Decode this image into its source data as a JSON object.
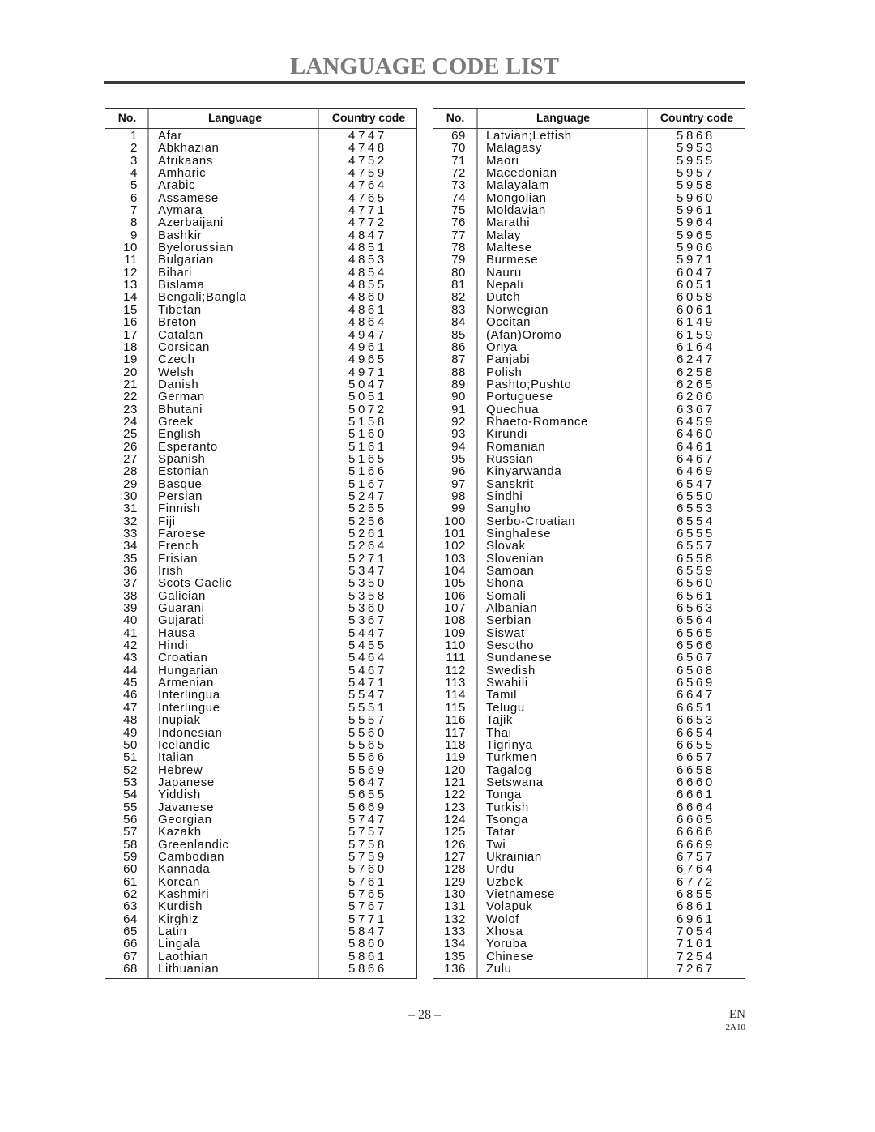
{
  "title": "LANGUAGE CODE LIST",
  "headers": {
    "no": "No.",
    "language": "Language",
    "code": "Country code"
  },
  "left_table": [
    {
      "no": "1",
      "language": "Afar",
      "code": "4747"
    },
    {
      "no": "2",
      "language": "Abkhazian",
      "code": "4748"
    },
    {
      "no": "3",
      "language": "Afrikaans",
      "code": "4752"
    },
    {
      "no": "4",
      "language": "Amharic",
      "code": "4759"
    },
    {
      "no": "5",
      "language": "Arabic",
      "code": "4764"
    },
    {
      "no": "6",
      "language": "Assamese",
      "code": "4765"
    },
    {
      "no": "7",
      "language": "Aymara",
      "code": "4771"
    },
    {
      "no": "8",
      "language": "Azerbaijani",
      "code": "4772"
    },
    {
      "no": "9",
      "language": "Bashkir",
      "code": "4847"
    },
    {
      "no": "10",
      "language": "Byelorussian",
      "code": "4851"
    },
    {
      "no": "11",
      "language": "Bulgarian",
      "code": "4853"
    },
    {
      "no": "12",
      "language": "Bihari",
      "code": "4854"
    },
    {
      "no": "13",
      "language": "Bislama",
      "code": "4855"
    },
    {
      "no": "14",
      "language": "Bengali;Bangla",
      "code": "4860"
    },
    {
      "no": "15",
      "language": "Tibetan",
      "code": "4861"
    },
    {
      "no": "16",
      "language": "Breton",
      "code": "4864"
    },
    {
      "no": "17",
      "language": "Catalan",
      "code": "4947"
    },
    {
      "no": "18",
      "language": "Corsican",
      "code": "4961"
    },
    {
      "no": "19",
      "language": "Czech",
      "code": "4965"
    },
    {
      "no": "20",
      "language": "Welsh",
      "code": "4971"
    },
    {
      "no": "21",
      "language": "Danish",
      "code": "5047"
    },
    {
      "no": "22",
      "language": "German",
      "code": "5051"
    },
    {
      "no": "23",
      "language": "Bhutani",
      "code": "5072"
    },
    {
      "no": "24",
      "language": "Greek",
      "code": "5158"
    },
    {
      "no": "25",
      "language": "English",
      "code": "5160"
    },
    {
      "no": "26",
      "language": "Esperanto",
      "code": "5161"
    },
    {
      "no": "27",
      "language": "Spanish",
      "code": "5165"
    },
    {
      "no": "28",
      "language": "Estonian",
      "code": "5166"
    },
    {
      "no": "29",
      "language": "Basque",
      "code": "5167"
    },
    {
      "no": "30",
      "language": "Persian",
      "code": "5247"
    },
    {
      "no": "31",
      "language": "Finnish",
      "code": "5255"
    },
    {
      "no": "32",
      "language": "Fiji",
      "code": "5256"
    },
    {
      "no": "33",
      "language": "Faroese",
      "code": "5261"
    },
    {
      "no": "34",
      "language": "French",
      "code": "5264"
    },
    {
      "no": "35",
      "language": "Frisian",
      "code": "5271"
    },
    {
      "no": "36",
      "language": "Irish",
      "code": "5347"
    },
    {
      "no": "37",
      "language": "Scots Gaelic",
      "code": "5350"
    },
    {
      "no": "38",
      "language": "Galician",
      "code": "5358"
    },
    {
      "no": "39",
      "language": "Guarani",
      "code": "5360"
    },
    {
      "no": "40",
      "language": "Gujarati",
      "code": "5367"
    },
    {
      "no": "41",
      "language": "Hausa",
      "code": "5447"
    },
    {
      "no": "42",
      "language": "Hindi",
      "code": "5455"
    },
    {
      "no": "43",
      "language": "Croatian",
      "code": "5464"
    },
    {
      "no": "44",
      "language": "Hungarian",
      "code": "5467"
    },
    {
      "no": "45",
      "language": "Armenian",
      "code": "5471"
    },
    {
      "no": "46",
      "language": "Interlingua",
      "code": "5547"
    },
    {
      "no": "47",
      "language": "Interlingue",
      "code": "5551"
    },
    {
      "no": "48",
      "language": "Inupiak",
      "code": "5557"
    },
    {
      "no": "49",
      "language": "Indonesian",
      "code": "5560"
    },
    {
      "no": "50",
      "language": "Icelandic",
      "code": "5565"
    },
    {
      "no": "51",
      "language": "Italian",
      "code": "5566"
    },
    {
      "no": "52",
      "language": "Hebrew",
      "code": "5569"
    },
    {
      "no": "53",
      "language": "Japanese",
      "code": "5647"
    },
    {
      "no": "54",
      "language": "Yiddish",
      "code": "5655"
    },
    {
      "no": "55",
      "language": "Javanese",
      "code": "5669"
    },
    {
      "no": "56",
      "language": "Georgian",
      "code": "5747"
    },
    {
      "no": "57",
      "language": "Kazakh",
      "code": "5757"
    },
    {
      "no": "58",
      "language": "Greenlandic",
      "code": "5758"
    },
    {
      "no": "59",
      "language": "Cambodian",
      "code": "5759"
    },
    {
      "no": "60",
      "language": "Kannada",
      "code": "5760"
    },
    {
      "no": "61",
      "language": "Korean",
      "code": "5761"
    },
    {
      "no": "62",
      "language": "Kashmiri",
      "code": "5765"
    },
    {
      "no": "63",
      "language": "Kurdish",
      "code": "5767"
    },
    {
      "no": "64",
      "language": "Kirghiz",
      "code": "5771"
    },
    {
      "no": "65",
      "language": "Latin",
      "code": "5847"
    },
    {
      "no": "66",
      "language": "Lingala",
      "code": "5860"
    },
    {
      "no": "67",
      "language": "Laothian",
      "code": "5861"
    },
    {
      "no": "68",
      "language": "Lithuanian",
      "code": "5866"
    }
  ],
  "right_table": [
    {
      "no": "69",
      "language": "Latvian;Lettish",
      "code": "5868"
    },
    {
      "no": "70",
      "language": "Malagasy",
      "code": "5953"
    },
    {
      "no": "71",
      "language": "Maori",
      "code": "5955"
    },
    {
      "no": "72",
      "language": "Macedonian",
      "code": "5957"
    },
    {
      "no": "73",
      "language": "Malayalam",
      "code": "5958"
    },
    {
      "no": "74",
      "language": "Mongolian",
      "code": "5960"
    },
    {
      "no": "75",
      "language": "Moldavian",
      "code": "5961"
    },
    {
      "no": "76",
      "language": "Marathi",
      "code": "5964"
    },
    {
      "no": "77",
      "language": "Malay",
      "code": "5965"
    },
    {
      "no": "78",
      "language": "Maltese",
      "code": "5966"
    },
    {
      "no": "79",
      "language": "Burmese",
      "code": "5971"
    },
    {
      "no": "80",
      "language": "Nauru",
      "code": "6047"
    },
    {
      "no": "81",
      "language": "Nepali",
      "code": "6051"
    },
    {
      "no": "82",
      "language": "Dutch",
      "code": "6058"
    },
    {
      "no": "83",
      "language": "Norwegian",
      "code": "6061"
    },
    {
      "no": "84",
      "language": "Occitan",
      "code": "6149"
    },
    {
      "no": "85",
      "language": "(Afan)Oromo",
      "code": "6159"
    },
    {
      "no": "86",
      "language": "Oriya",
      "code": "6164"
    },
    {
      "no": "87",
      "language": "Panjabi",
      "code": "6247"
    },
    {
      "no": "88",
      "language": "Polish",
      "code": "6258"
    },
    {
      "no": "89",
      "language": "Pashto;Pushto",
      "code": "6265"
    },
    {
      "no": "90",
      "language": "Portuguese",
      "code": "6266"
    },
    {
      "no": "91",
      "language": "Quechua",
      "code": "6367"
    },
    {
      "no": "92",
      "language": "Rhaeto-Romance",
      "code": "6459"
    },
    {
      "no": "93",
      "language": "Kirundi",
      "code": "6460"
    },
    {
      "no": "94",
      "language": "Romanian",
      "code": "6461"
    },
    {
      "no": "95",
      "language": "Russian",
      "code": "6467"
    },
    {
      "no": "96",
      "language": "Kinyarwanda",
      "code": "6469"
    },
    {
      "no": "97",
      "language": "Sanskrit",
      "code": "6547"
    },
    {
      "no": "98",
      "language": "Sindhi",
      "code": "6550"
    },
    {
      "no": "99",
      "language": "Sangho",
      "code": "6553"
    },
    {
      "no": "100",
      "language": "Serbo-Croatian",
      "code": "6554"
    },
    {
      "no": "101",
      "language": "Singhalese",
      "code": "6555"
    },
    {
      "no": "102",
      "language": "Slovak",
      "code": "6557"
    },
    {
      "no": "103",
      "language": "Slovenian",
      "code": "6558"
    },
    {
      "no": "104",
      "language": "Samoan",
      "code": "6559"
    },
    {
      "no": "105",
      "language": "Shona",
      "code": "6560"
    },
    {
      "no": "106",
      "language": "Somali",
      "code": "6561"
    },
    {
      "no": "107",
      "language": "Albanian",
      "code": "6563"
    },
    {
      "no": "108",
      "language": "Serbian",
      "code": "6564"
    },
    {
      "no": "109",
      "language": "Siswat",
      "code": "6565"
    },
    {
      "no": "110",
      "language": "Sesotho",
      "code": "6566"
    },
    {
      "no": "111",
      "language": "Sundanese",
      "code": "6567"
    },
    {
      "no": "112",
      "language": "Swedish",
      "code": "6568"
    },
    {
      "no": "113",
      "language": "Swahili",
      "code": "6569"
    },
    {
      "no": "114",
      "language": "Tamil",
      "code": "6647"
    },
    {
      "no": "115",
      "language": "Telugu",
      "code": "6651"
    },
    {
      "no": "116",
      "language": "Tajik",
      "code": "6653"
    },
    {
      "no": "117",
      "language": "Thai",
      "code": "6654"
    },
    {
      "no": "118",
      "language": "Tigrinya",
      "code": "6655"
    },
    {
      "no": "119",
      "language": "Turkmen",
      "code": "6657"
    },
    {
      "no": "120",
      "language": "Tagalog",
      "code": "6658"
    },
    {
      "no": "121",
      "language": "Setswana",
      "code": "6660"
    },
    {
      "no": "122",
      "language": "Tonga",
      "code": "6661"
    },
    {
      "no": "123",
      "language": "Turkish",
      "code": "6664"
    },
    {
      "no": "124",
      "language": "Tsonga",
      "code": "6665"
    },
    {
      "no": "125",
      "language": "Tatar",
      "code": "6666"
    },
    {
      "no": "126",
      "language": "Twi",
      "code": "6669"
    },
    {
      "no": "127",
      "language": "Ukrainian",
      "code": "6757"
    },
    {
      "no": "128",
      "language": "Urdu",
      "code": "6764"
    },
    {
      "no": "129",
      "language": "Uzbek",
      "code": "6772"
    },
    {
      "no": "130",
      "language": "Vietnamese",
      "code": "6855"
    },
    {
      "no": "131",
      "language": "Volapuk",
      "code": "6861"
    },
    {
      "no": "132",
      "language": "Wolof",
      "code": "6961"
    },
    {
      "no": "133",
      "language": "Xhosa",
      "code": "7054"
    },
    {
      "no": "134",
      "language": "Yoruba",
      "code": "7161"
    },
    {
      "no": "135",
      "language": "Chinese",
      "code": "7254"
    },
    {
      "no": "136",
      "language": "Zulu",
      "code": "7267"
    }
  ],
  "footer": {
    "page_number": "– 28 –",
    "language": "EN",
    "model_code": "2A10"
  },
  "colors": {
    "title": "#7a7a7a",
    "rule": "#3a3a3a"
  }
}
